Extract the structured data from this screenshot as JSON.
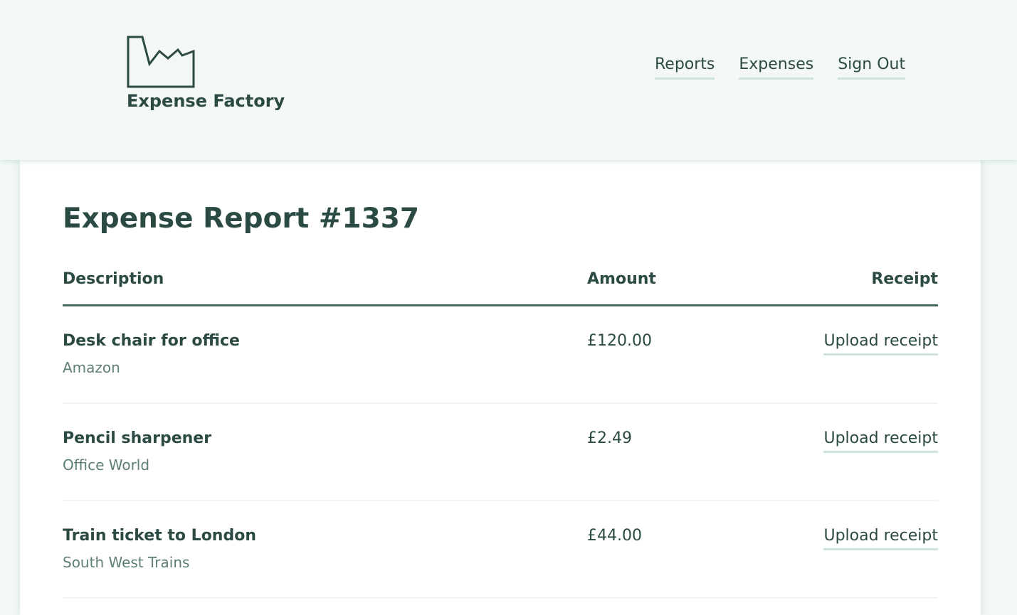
{
  "brand": {
    "name": "Expense Factory",
    "logo_icon": "factory-icon",
    "color": "#2c4a44"
  },
  "nav": {
    "items": [
      {
        "label": "Reports"
      },
      {
        "label": "Expenses"
      },
      {
        "label": "Sign Out"
      }
    ]
  },
  "report": {
    "title": "Expense Report #1337",
    "columns": {
      "description": "Description",
      "amount": "Amount",
      "receipt": "Receipt"
    },
    "rows": [
      {
        "description": "Desk chair for office",
        "vendor": "Amazon",
        "amount": "£120.00",
        "receipt_action": "Upload receipt"
      },
      {
        "description": "Pencil sharpener",
        "vendor": "Office World",
        "amount": "£2.49",
        "receipt_action": "Upload receipt"
      },
      {
        "description": "Train ticket to London",
        "vendor": "South West Trains",
        "amount": "£44.00",
        "receipt_action": "Upload receipt"
      }
    ]
  },
  "colors": {
    "background": "#f3f8f5",
    "card": "#ffffff",
    "text": "#2c4a44",
    "muted": "#5e7e76",
    "underline": "#cfe5db"
  }
}
